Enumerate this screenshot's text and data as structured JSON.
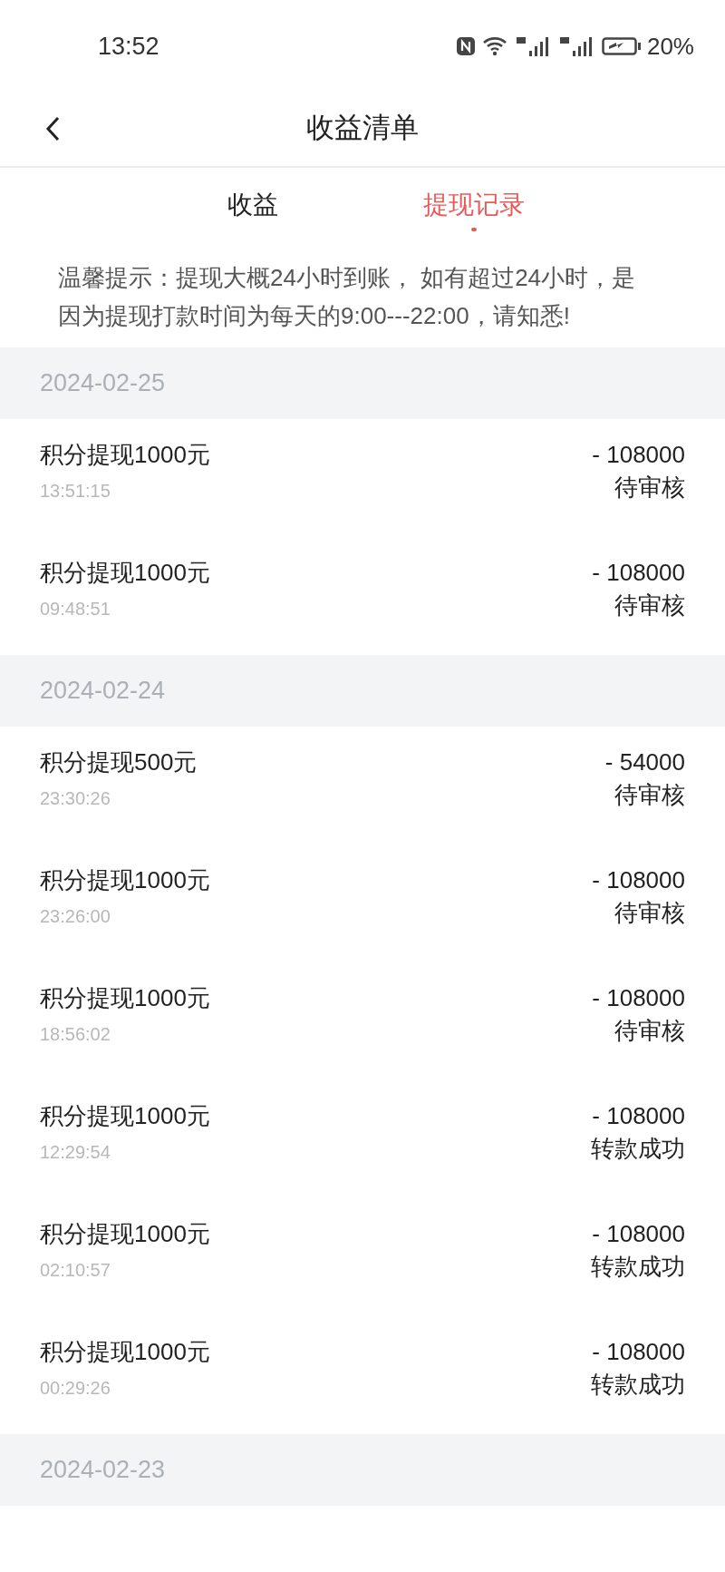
{
  "status_bar": {
    "time": "13:52",
    "battery": "20%"
  },
  "header": {
    "title": "收益清单"
  },
  "tabs": [
    {
      "label": "收益",
      "selected": false
    },
    {
      "label": "提现记录",
      "selected": true
    }
  ],
  "notice": "温馨提示：提现大概24小时到账， 如有超过24小时，是因为提现打款时间为每天的9:00---22:00，请知悉!",
  "groups": [
    {
      "date": "2024-02-25",
      "records": [
        {
          "title": "积分提现1000元",
          "time": "13:51:15",
          "amount": "- 108000",
          "status": "待审核"
        },
        {
          "title": "积分提现1000元",
          "time": "09:48:51",
          "amount": "- 108000",
          "status": "待审核"
        }
      ]
    },
    {
      "date": "2024-02-24",
      "records": [
        {
          "title": "积分提现500元",
          "time": "23:30:26",
          "amount": "- 54000",
          "status": "待审核"
        },
        {
          "title": "积分提现1000元",
          "time": "23:26:00",
          "amount": "- 108000",
          "status": "待审核"
        },
        {
          "title": "积分提现1000元",
          "time": "18:56:02",
          "amount": "- 108000",
          "status": "待审核"
        },
        {
          "title": "积分提现1000元",
          "time": "12:29:54",
          "amount": "- 108000",
          "status": "转款成功"
        },
        {
          "title": "积分提现1000元",
          "time": "02:10:57",
          "amount": "- 108000",
          "status": "转款成功"
        },
        {
          "title": "积分提现1000元",
          "time": "00:29:26",
          "amount": "- 108000",
          "status": "转款成功"
        }
      ]
    },
    {
      "date": "2024-02-23"
    }
  ]
}
